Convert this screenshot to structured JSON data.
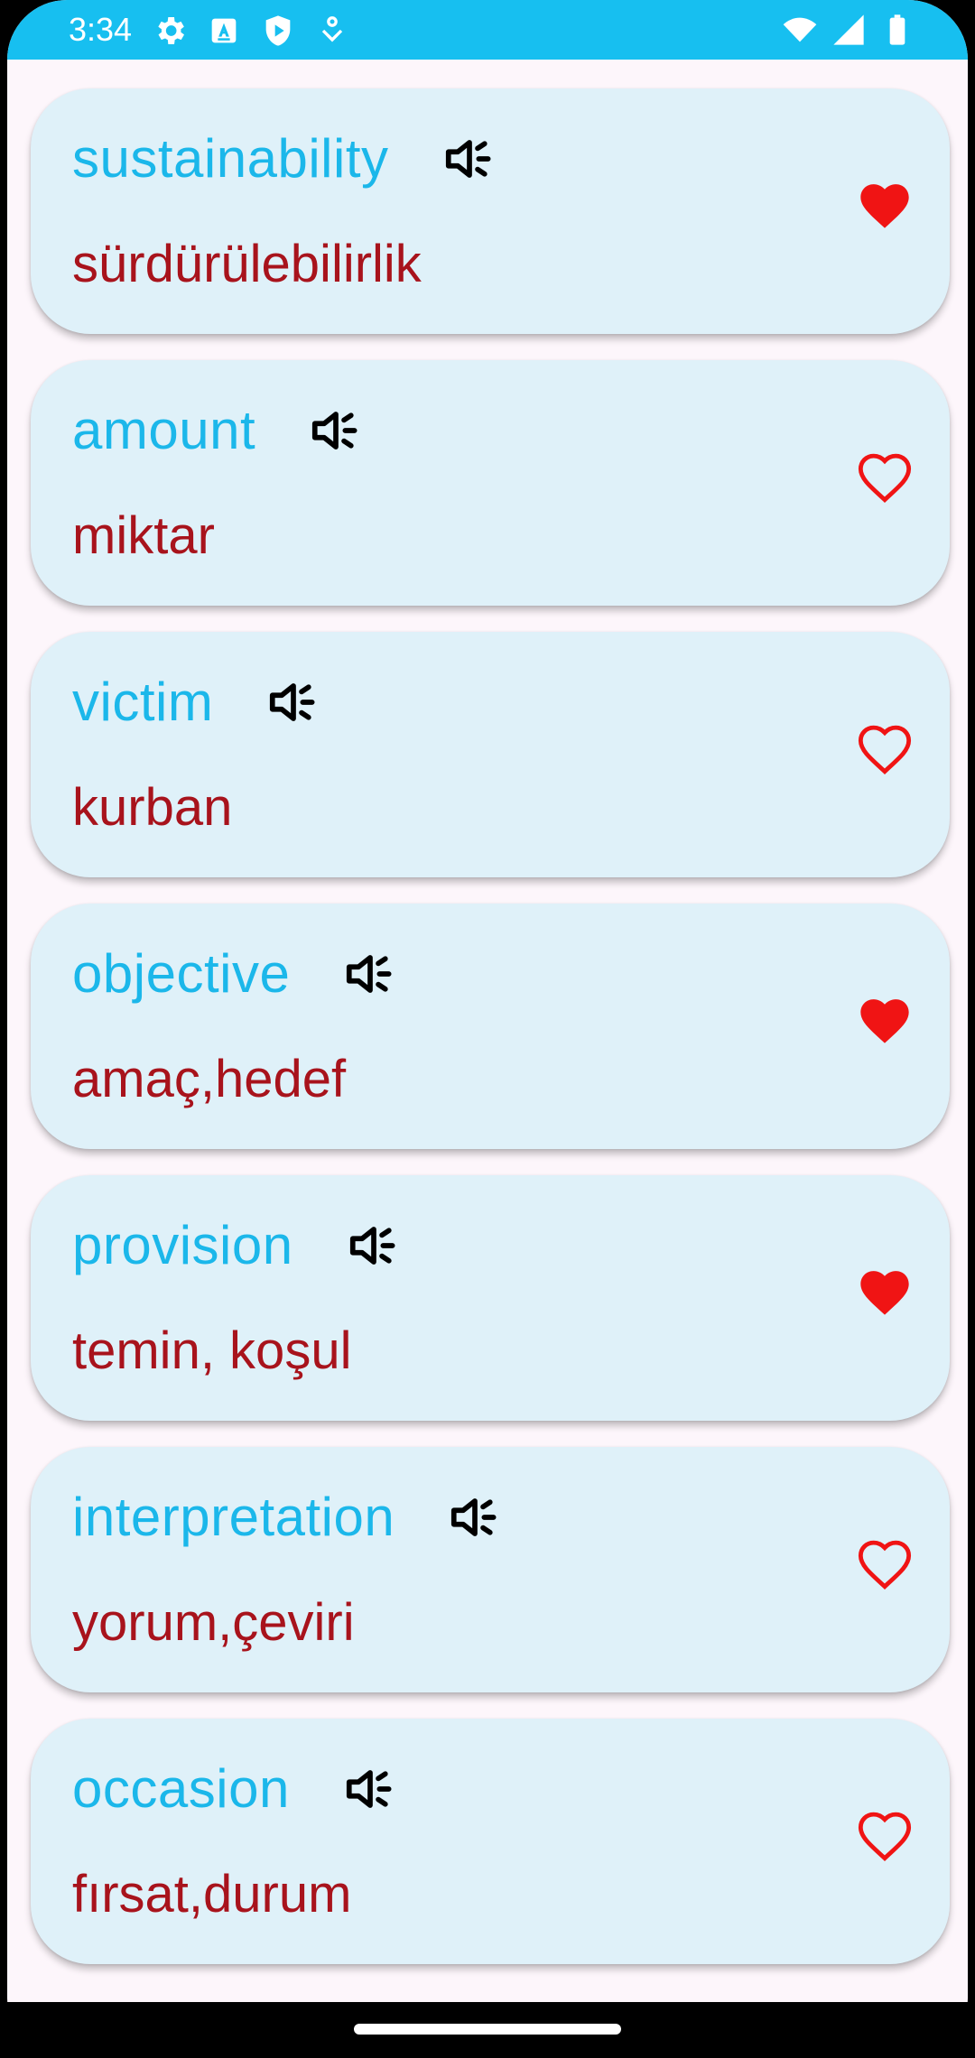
{
  "status_bar": {
    "time": "3:34",
    "left_icons": [
      "gear-icon",
      "font-a-icon",
      "shield-play-icon",
      "download-icon"
    ],
    "right_icons": [
      "wifi-icon",
      "signal-icon",
      "battery-icon"
    ],
    "background": "#17bff0"
  },
  "colors": {
    "word": "#1bb7ea",
    "translation": "#a8131c",
    "card_bg": "#dff1f9",
    "heart": "#f01414"
  },
  "words": [
    {
      "word": "sustainability",
      "translation": "sürdürülebilirlik",
      "favorite": true
    },
    {
      "word": "amount",
      "translation": "miktar",
      "favorite": false
    },
    {
      "word": "victim",
      "translation": "kurban",
      "favorite": false
    },
    {
      "word": "objective",
      "translation": "amaç,hedef",
      "favorite": true
    },
    {
      "word": "provision",
      "translation": "temin, koşul",
      "favorite": true
    },
    {
      "word": "interpretation",
      "translation": "yorum,çeviri",
      "favorite": false
    },
    {
      "word": "occasion",
      "translation": "fırsat,durum",
      "favorite": false
    }
  ]
}
